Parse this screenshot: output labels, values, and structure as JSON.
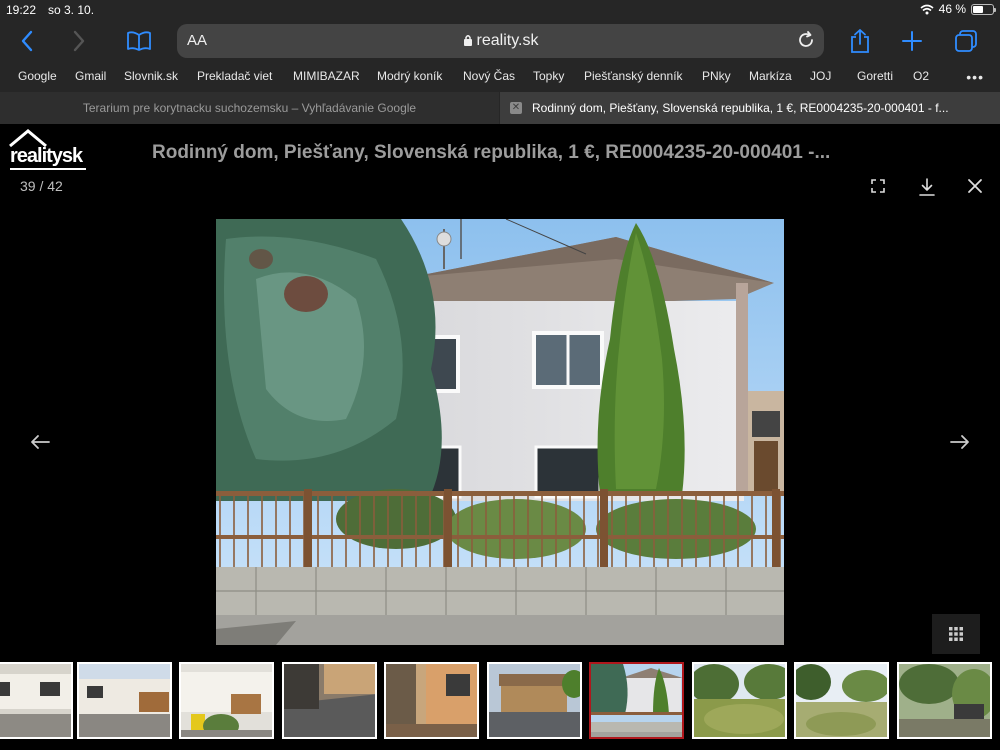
{
  "status": {
    "time": "19:22",
    "date": "so 3. 10.",
    "battery": "46 %",
    "battery_level": 0.46
  },
  "browser": {
    "aa": "AA",
    "url": "reality.sk",
    "bookmarks": [
      "Google",
      "Gmail",
      "Slovnik.sk",
      "Prekladač viet",
      "MIMIBAZAR",
      "Modrý koník",
      "Nový Čas",
      "Topky",
      "Piešťanský denník",
      "PNky",
      "Markíza",
      "JOJ",
      "Goretti",
      "O2"
    ],
    "more": "•••",
    "tabs": [
      {
        "title": "Terarium pre korytnacku suchozemsku – Vyhľadávanie Google"
      },
      {
        "title": "Rodinný dom, Piešťany, Slovenská republika, 1 €, RE0004235-20-000401 - f..."
      }
    ],
    "icons": {
      "back": "chevron-left-icon",
      "forward": "chevron-right-icon",
      "bookmarks": "book-icon",
      "lock": "lock-icon",
      "reload": "reload-icon",
      "share": "share-icon",
      "new_tab": "plus-icon",
      "tabs": "tabs-icon"
    }
  },
  "gallery": {
    "logo": "realitysk",
    "title": "Rodinný dom, Piešťany, Slovenská republika, 1 €, RE0004235-20-000401 -...",
    "counter": "39 / 42",
    "active_thumbnail": 7,
    "thumbnail_count": 10,
    "icons": {
      "fullscreen": "fullscreen-icon",
      "download": "download-icon",
      "close": "close-icon",
      "prev": "arrow-left-icon",
      "next": "arrow-right-icon",
      "grid": "grid-icon"
    }
  },
  "colors": {
    "accent": "#2f8cff",
    "active_thumb_border": "#b0171c",
    "chrome_bg": "#262626"
  }
}
